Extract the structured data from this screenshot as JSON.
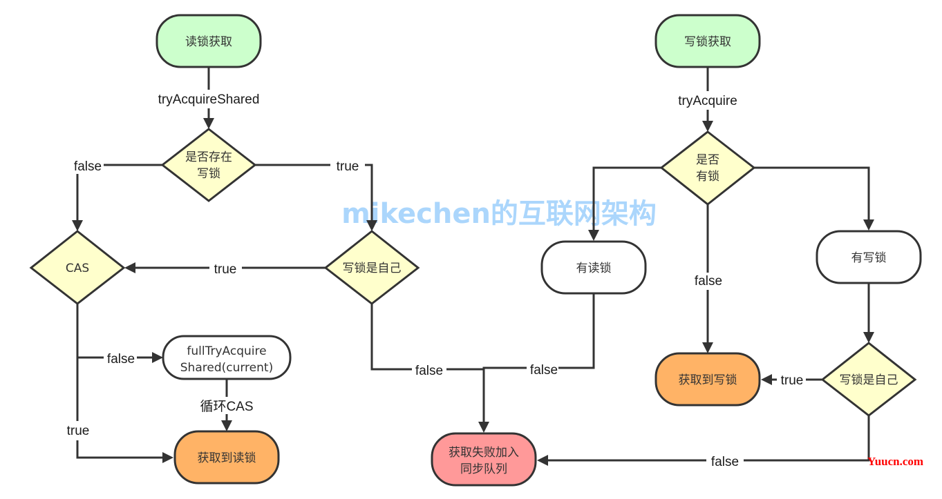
{
  "colors": {
    "start": "#ccffcc",
    "decision": "#ffffcc",
    "process": "#ffffff",
    "success": "#ffb366",
    "failure": "#ff9999",
    "stroke": "#333333",
    "watermark": "#8fc9fb",
    "credit": "#ff0000"
  },
  "watermark": "mikechen的互联网架构",
  "credit": "Yuucn.com",
  "read_flow": {
    "start": "读锁获取",
    "call_label": "tryAcquireShared",
    "has_write_lock": [
      "是否存在",
      "写锁"
    ],
    "has_write_lock_false": "false",
    "has_write_lock_true": "true",
    "write_lock_is_self": "写锁是自己",
    "write_lock_is_self_true": "true",
    "write_lock_is_self_false": "false",
    "cas": "CAS",
    "cas_false": "false",
    "cas_true": "true",
    "full_try": [
      "fullTryAcquire",
      "Shared(current)"
    ],
    "loop_cas": "循环CAS",
    "acquired": "获取到读锁"
  },
  "write_flow": {
    "start": "写锁获取",
    "call_label": "tryAcquire",
    "has_lock": [
      "是否",
      "有锁"
    ],
    "has_lock_false": "false",
    "has_read_lock": "有读锁",
    "has_read_lock_false": "false",
    "has_write_lock": "有写锁",
    "write_lock_is_self": "写锁是自己",
    "write_lock_is_self_true": "true",
    "write_lock_is_self_false": "false",
    "acquired": "获取到写锁"
  },
  "failure": [
    "获取失败加入",
    "同步队列"
  ]
}
